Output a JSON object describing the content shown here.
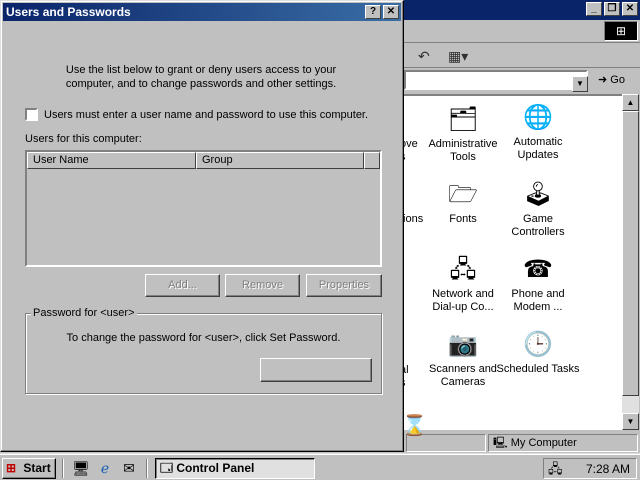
{
  "dialog": {
    "title": "Users and Passwords",
    "help_button": "?",
    "close_button": "✕",
    "intro": "Use the list below to grant or deny users access to your computer, and to change passwords and other settings.",
    "checkbox_label": "Users must enter a user name and password to use this computer.",
    "checkbox_checked": false,
    "users_label": "Users for this computer:",
    "columns": [
      "User Name",
      "Group"
    ],
    "rows": [],
    "buttons": {
      "add": "Add...",
      "remove": "Remove",
      "properties": "Properties"
    },
    "password_group": {
      "title": "Password for <user>",
      "text": "To change the password for <user>, click Set Password.",
      "set_password_label": ""
    }
  },
  "control_panel": {
    "title_buttons": [
      "_",
      "❐",
      "✕"
    ],
    "go_label": "Go",
    "items": [
      {
        "label": "Administrative Tools",
        "icon": "administrative-tools-icon"
      },
      {
        "label": "Automatic Updates",
        "icon": "automatic-updates-icon"
      },
      {
        "label": "Fonts",
        "icon": "fonts-icon"
      },
      {
        "label": "Game Controllers",
        "icon": "game-controllers-icon"
      },
      {
        "label": "Network and Dial-up Co...",
        "icon": "network-dialup-icon"
      },
      {
        "label": "Phone and Modem ...",
        "icon": "phone-modem-icon"
      },
      {
        "label": "Scanners and Cameras",
        "icon": "scanners-cameras-icon"
      },
      {
        "label": "Scheduled Tasks",
        "icon": "scheduled-tasks-icon"
      }
    ],
    "partial_labels": [
      "ove",
      "s",
      "tions",
      "al",
      "s"
    ],
    "status_zone": "My Computer"
  },
  "taskbar": {
    "start_label": "Start",
    "task_label": "Control Panel",
    "clock": "7:28 AM"
  },
  "colors": {
    "face": "#c0c0c0",
    "title_active": "#0a246a",
    "title_gradient_end": "#3a6ea5",
    "window_bg": "#ffffff"
  }
}
